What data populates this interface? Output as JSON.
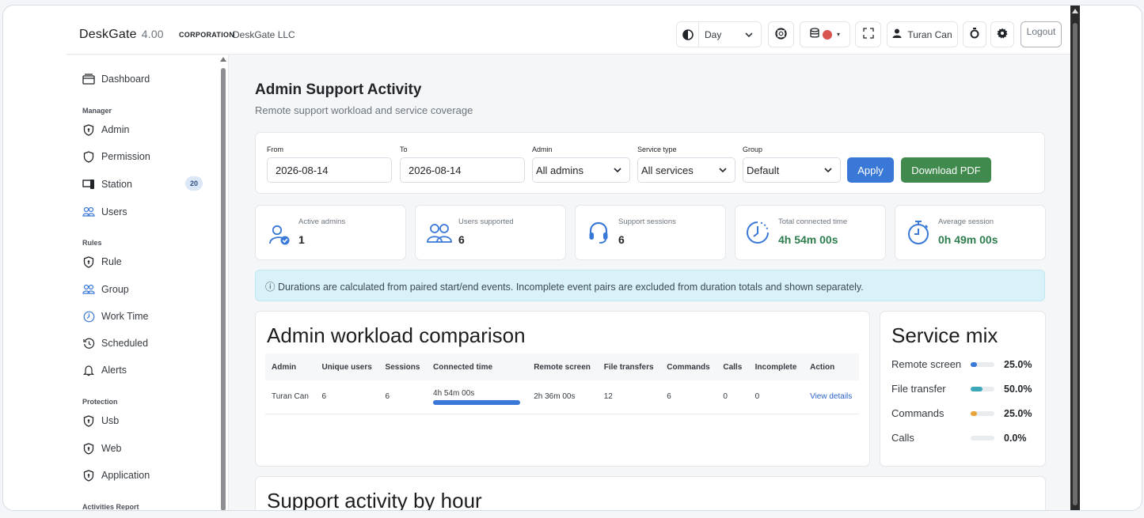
{
  "header": {
    "brand": "DeskGate",
    "version": "4.00",
    "corp_label": "CORPORATION",
    "corp_name": "DeskGate LLC",
    "theme_value": "Day",
    "user_name": "Turan Can",
    "logout_label": "Logout"
  },
  "sidebar": {
    "dashboard": "Dashboard",
    "section_manager": "Manager",
    "admin": "Admin",
    "permission": "Permission",
    "station": "Station",
    "station_badge": "20",
    "users": "Users",
    "section_rules": "Rules",
    "rule": "Rule",
    "group": "Group",
    "work_time": "Work Time",
    "scheduled": "Scheduled",
    "alerts": "Alerts",
    "section_protection": "Protection",
    "usb": "Usb",
    "web": "Web",
    "application": "Application",
    "section_activities": "Activities Report"
  },
  "page": {
    "title": "Admin Support Activity",
    "subtitle": "Remote support workload and service coverage"
  },
  "filters": {
    "from_label": "From",
    "from_value": "2026-08-14",
    "to_label": "To",
    "to_value": "2026-08-14",
    "admin_label": "Admin",
    "admin_value": "All admins",
    "service_label": "Service type",
    "service_value": "All services",
    "group_label": "Group",
    "group_value": "Default",
    "apply_label": "Apply",
    "download_label": "Download PDF"
  },
  "stats": {
    "active_admins_label": "Active admins",
    "active_admins_value": "1",
    "users_supported_label": "Users supported",
    "users_supported_value": "6",
    "support_sessions_label": "Support sessions",
    "support_sessions_value": "6",
    "total_time_label": "Total connected time",
    "total_time_value": "4h 54m 00s",
    "avg_session_label": "Average session",
    "avg_session_value": "0h 49m 00s"
  },
  "alert_text": "ⓘ Durations are calculated from paired start/end events. Incomplete event pairs are excluded from duration totals and shown separately.",
  "workload": {
    "title": "Admin workload comparison",
    "columns": [
      "Admin",
      "Unique users",
      "Sessions",
      "Connected time",
      "Remote screen",
      "File transfers",
      "Commands",
      "Calls",
      "Incomplete",
      "Action"
    ],
    "rows": [
      {
        "admin": "Turan Can",
        "unique_users": "6",
        "sessions": "6",
        "connected_time": "4h 54m 00s",
        "connected_fraction": 1.0,
        "remote_screen": "2h 36m 00s",
        "file_transfers": "12",
        "commands": "6",
        "calls": "0",
        "incomplete": "0",
        "action": "View details"
      }
    ]
  },
  "service_mix": {
    "title": "Service mix",
    "items": [
      {
        "label": "Remote screen",
        "pct": "25.0%",
        "fraction": 0.25,
        "color": "#3a78d8"
      },
      {
        "label": "File transfer",
        "pct": "50.0%",
        "fraction": 0.5,
        "color": "#3ba7b8"
      },
      {
        "label": "Commands",
        "pct": "25.0%",
        "fraction": 0.25,
        "color": "#e8a33a"
      },
      {
        "label": "Calls",
        "pct": "0.0%",
        "fraction": 0.0,
        "color": "#9aa3ad"
      }
    ]
  },
  "hourly": {
    "title": "Support activity by hour"
  }
}
